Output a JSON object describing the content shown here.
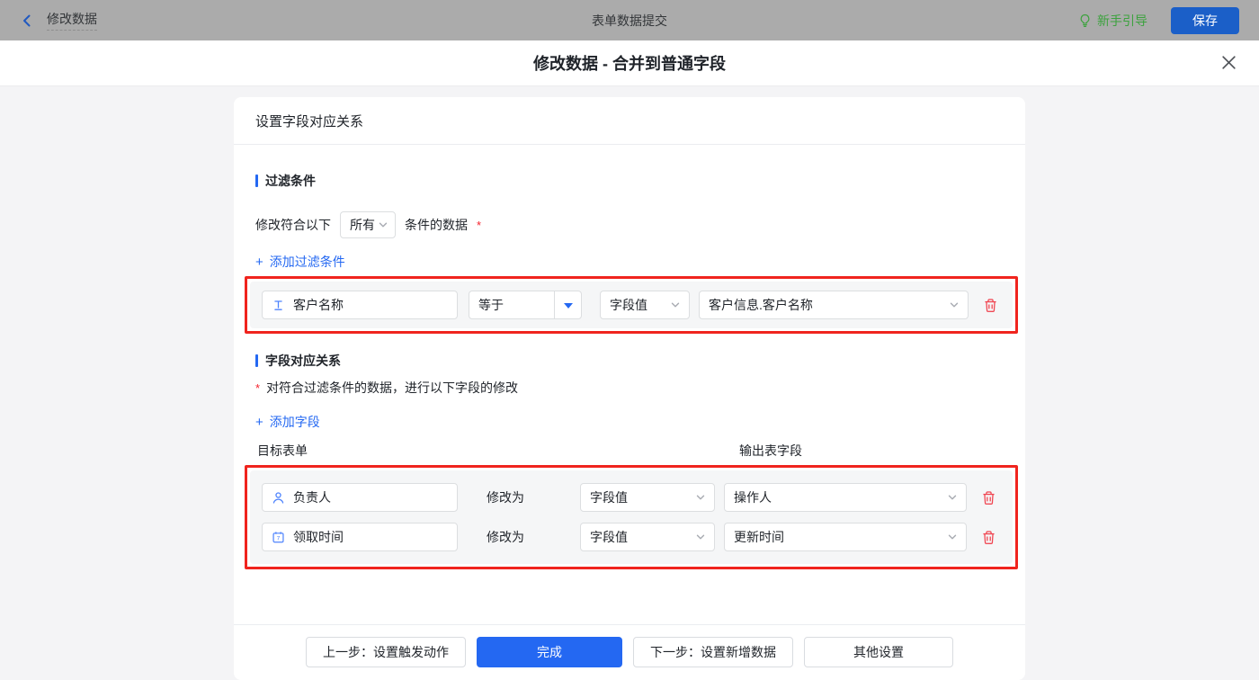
{
  "topbar": {
    "back_label": "修改数据",
    "title": "表单数据提交",
    "guide_label": "新手引导",
    "save_label": "保存"
  },
  "dialog": {
    "title": "修改数据 - 合并到普通字段"
  },
  "card": {
    "header": "设置字段对应关系",
    "filter": {
      "title": "过滤条件",
      "match_prefix": "修改符合以下",
      "match_select_value": "所有",
      "match_suffix": "条件的数据",
      "required_mark": "*",
      "add_label": "添加过滤条件",
      "plus": "+",
      "row": {
        "field": "客户名称",
        "field_icon": "text-field-icon",
        "operator": "等于",
        "value_type": "字段值",
        "value": "客户信息.客户名称"
      }
    },
    "mapping": {
      "title": "字段对应关系",
      "required_mark": "*",
      "description": "对符合过滤条件的数据，进行以下字段的修改",
      "add_label": "添加字段",
      "plus": "+",
      "col_target": "目标表单",
      "col_output": "输出表字段",
      "modify_label": "修改为",
      "rows": [
        {
          "field": "负责人",
          "field_icon": "user-icon",
          "value_type": "字段值",
          "value": "操作人"
        },
        {
          "field": "领取时间",
          "field_icon": "calendar-icon",
          "value_type": "字段值",
          "value": "更新时间"
        }
      ]
    },
    "footer": {
      "prev": "上一步：设置触发动作",
      "done": "完成",
      "next": "下一步：设置新增数据",
      "other": "其他设置"
    }
  },
  "colors": {
    "accent_blue": "#2468f2",
    "highlight_red": "#f0241e",
    "delete_red": "#f0434f",
    "guide_green": "#3ca23e",
    "save_blue": "#1b5fc8",
    "topbar_gray": "#ababab"
  },
  "icons": {
    "back": "chevron-left",
    "guide": "lightbulb",
    "close": "x-mark",
    "field_text": "T-with-underline",
    "field_user": "person-outline",
    "field_calendar": "calendar-7",
    "delete": "trash-can",
    "select_caret": "chevron-down",
    "operator_caret": "filled-triangle-down"
  }
}
